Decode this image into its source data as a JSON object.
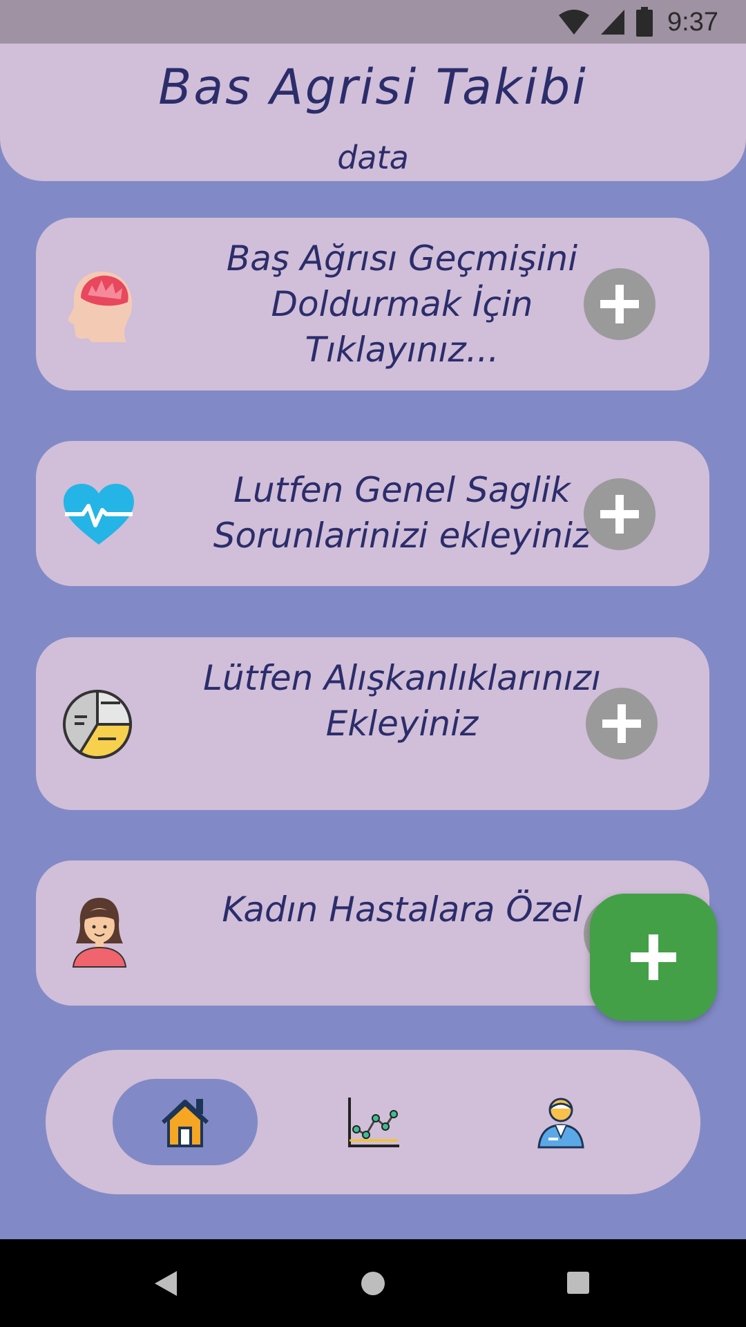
{
  "status_bar": {
    "time": "9:37",
    "icons": [
      "wifi-icon",
      "signal-icon",
      "battery-icon"
    ]
  },
  "header": {
    "title": "Bas Agrisi Takibi",
    "subtitle": "data"
  },
  "cards": [
    {
      "icon": "brain-headache-icon",
      "text": "Baş Ağrısı Geçmişini Doldurmak İçin Tıklayınız..."
    },
    {
      "icon": "heart-pulse-icon",
      "text": "Lutfen Genel Saglik Sorunlarinizi ekleyiniz"
    },
    {
      "icon": "pie-chart-icon",
      "text": "Lütfen Alışkanlıklarınızı Ekleyiniz"
    },
    {
      "icon": "woman-avatar-icon",
      "text": "Kadın Hastalara Özel"
    }
  ],
  "fab": {
    "icon": "plus-icon"
  },
  "bottom_nav": {
    "items": [
      {
        "icon": "home-icon",
        "active": true
      },
      {
        "icon": "line-chart-icon",
        "active": false
      },
      {
        "icon": "doctor-icon",
        "active": false
      }
    ]
  },
  "system_nav": {
    "icons": [
      "back-icon",
      "home-circle-icon",
      "recents-icon"
    ]
  },
  "colors": {
    "background": "#818ac6",
    "card": "#d1bed8",
    "text": "#2b2d6b",
    "fab": "#43a047",
    "plus_button": "#9a9a9a",
    "status_bar": "#9f92a2"
  }
}
